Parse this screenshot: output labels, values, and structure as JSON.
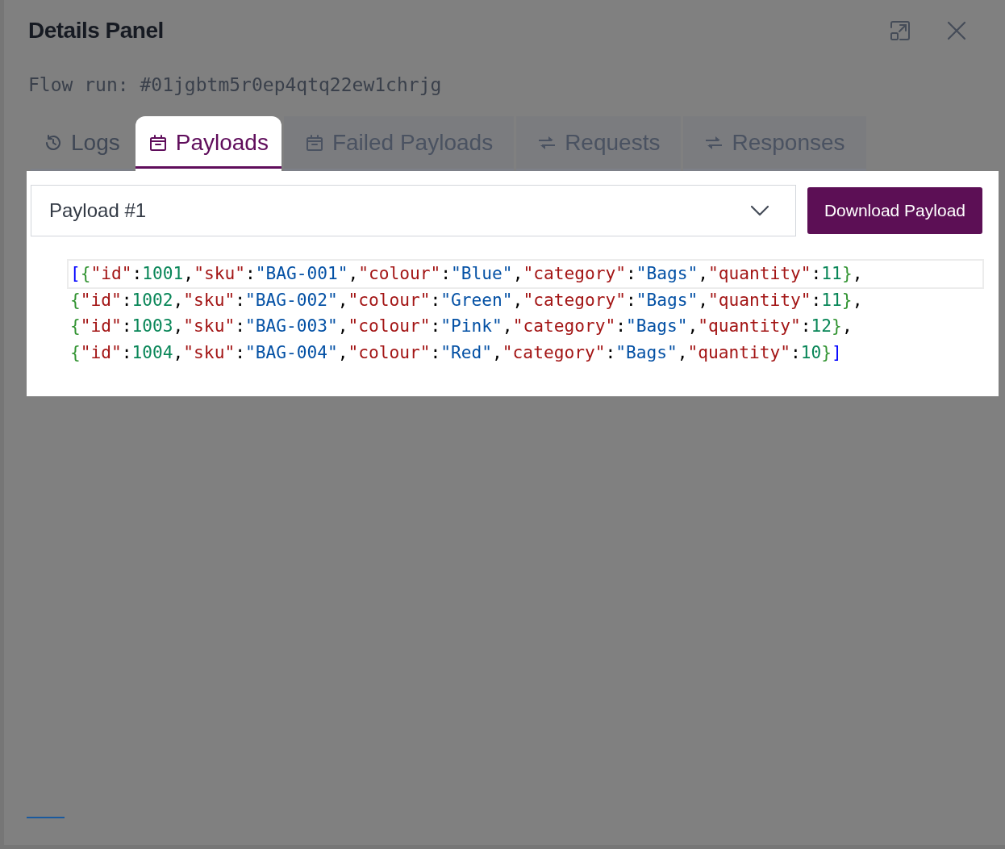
{
  "panel": {
    "title": "Details Panel",
    "subtitle": "Flow run: #01jgbtm5r0ep4qtq22ew1chrjg"
  },
  "tabs": [
    {
      "label": "Logs",
      "selected": false
    },
    {
      "label": "Payloads",
      "selected": true
    },
    {
      "label": "Failed Payloads",
      "selected": false
    },
    {
      "label": "Requests",
      "selected": false
    },
    {
      "label": "Responses",
      "selected": false
    }
  ],
  "payload_select": {
    "value": "Payload #1"
  },
  "download_button": "Download Payload",
  "code_lines": [
    [
      {
        "kind": "bracket",
        "t": "["
      },
      {
        "kind": "brace",
        "t": "{"
      },
      {
        "kind": "key",
        "t": "\"id\""
      },
      {
        "kind": "punct",
        "t": ":"
      },
      {
        "kind": "num",
        "t": "1001"
      },
      {
        "kind": "punct",
        "t": ","
      },
      {
        "kind": "key",
        "t": "\"sku\""
      },
      {
        "kind": "punct",
        "t": ":"
      },
      {
        "kind": "str",
        "t": "\"BAG-001\""
      },
      {
        "kind": "punct",
        "t": ","
      },
      {
        "kind": "key",
        "t": "\"colour\""
      },
      {
        "kind": "punct",
        "t": ":"
      },
      {
        "kind": "str",
        "t": "\"Blue\""
      },
      {
        "kind": "punct",
        "t": ","
      },
      {
        "kind": "key",
        "t": "\"category\""
      },
      {
        "kind": "punct",
        "t": ":"
      },
      {
        "kind": "str",
        "t": "\"Bags\""
      },
      {
        "kind": "punct",
        "t": ","
      },
      {
        "kind": "key",
        "t": "\"quantity\""
      },
      {
        "kind": "punct",
        "t": ":"
      },
      {
        "kind": "num",
        "t": "11"
      },
      {
        "kind": "brace",
        "t": "}"
      },
      {
        "kind": "punct",
        "t": ","
      }
    ],
    [
      {
        "kind": "brace",
        "t": "{"
      },
      {
        "kind": "key",
        "t": "\"id\""
      },
      {
        "kind": "punct",
        "t": ":"
      },
      {
        "kind": "num",
        "t": "1002"
      },
      {
        "kind": "punct",
        "t": ","
      },
      {
        "kind": "key",
        "t": "\"sku\""
      },
      {
        "kind": "punct",
        "t": ":"
      },
      {
        "kind": "str",
        "t": "\"BAG-002\""
      },
      {
        "kind": "punct",
        "t": ","
      },
      {
        "kind": "key",
        "t": "\"colour\""
      },
      {
        "kind": "punct",
        "t": ":"
      },
      {
        "kind": "str",
        "t": "\"Green\""
      },
      {
        "kind": "punct",
        "t": ","
      },
      {
        "kind": "key",
        "t": "\"category\""
      },
      {
        "kind": "punct",
        "t": ":"
      },
      {
        "kind": "str",
        "t": "\"Bags\""
      },
      {
        "kind": "punct",
        "t": ","
      },
      {
        "kind": "key",
        "t": "\"quantity\""
      },
      {
        "kind": "punct",
        "t": ":"
      },
      {
        "kind": "num",
        "t": "11"
      },
      {
        "kind": "brace",
        "t": "}"
      },
      {
        "kind": "punct",
        "t": ","
      }
    ],
    [
      {
        "kind": "brace",
        "t": "{"
      },
      {
        "kind": "key",
        "t": "\"id\""
      },
      {
        "kind": "punct",
        "t": ":"
      },
      {
        "kind": "num",
        "t": "1003"
      },
      {
        "kind": "punct",
        "t": ","
      },
      {
        "kind": "key",
        "t": "\"sku\""
      },
      {
        "kind": "punct",
        "t": ":"
      },
      {
        "kind": "str",
        "t": "\"BAG-003\""
      },
      {
        "kind": "punct",
        "t": ","
      },
      {
        "kind": "key",
        "t": "\"colour\""
      },
      {
        "kind": "punct",
        "t": ":"
      },
      {
        "kind": "str",
        "t": "\"Pink\""
      },
      {
        "kind": "punct",
        "t": ","
      },
      {
        "kind": "key",
        "t": "\"category\""
      },
      {
        "kind": "punct",
        "t": ":"
      },
      {
        "kind": "str",
        "t": "\"Bags\""
      },
      {
        "kind": "punct",
        "t": ","
      },
      {
        "kind": "key",
        "t": "\"quantity\""
      },
      {
        "kind": "punct",
        "t": ":"
      },
      {
        "kind": "num",
        "t": "12"
      },
      {
        "kind": "brace",
        "t": "}"
      },
      {
        "kind": "punct",
        "t": ","
      }
    ],
    [
      {
        "kind": "brace",
        "t": "{"
      },
      {
        "kind": "key",
        "t": "\"id\""
      },
      {
        "kind": "punct",
        "t": ":"
      },
      {
        "kind": "num",
        "t": "1004"
      },
      {
        "kind": "punct",
        "t": ","
      },
      {
        "kind": "key",
        "t": "\"sku\""
      },
      {
        "kind": "punct",
        "t": ":"
      },
      {
        "kind": "str",
        "t": "\"BAG-004\""
      },
      {
        "kind": "punct",
        "t": ","
      },
      {
        "kind": "key",
        "t": "\"colour\""
      },
      {
        "kind": "punct",
        "t": ":"
      },
      {
        "kind": "str",
        "t": "\"Red\""
      },
      {
        "kind": "punct",
        "t": ","
      },
      {
        "kind": "key",
        "t": "\"category\""
      },
      {
        "kind": "punct",
        "t": ":"
      },
      {
        "kind": "str",
        "t": "\"Bags\""
      },
      {
        "kind": "punct",
        "t": ","
      },
      {
        "kind": "key",
        "t": "\"quantity\""
      },
      {
        "kind": "punct",
        "t": ":"
      },
      {
        "kind": "num",
        "t": "10"
      },
      {
        "kind": "brace",
        "t": "}"
      },
      {
        "kind": "bracket",
        "t": "]"
      }
    ]
  ]
}
